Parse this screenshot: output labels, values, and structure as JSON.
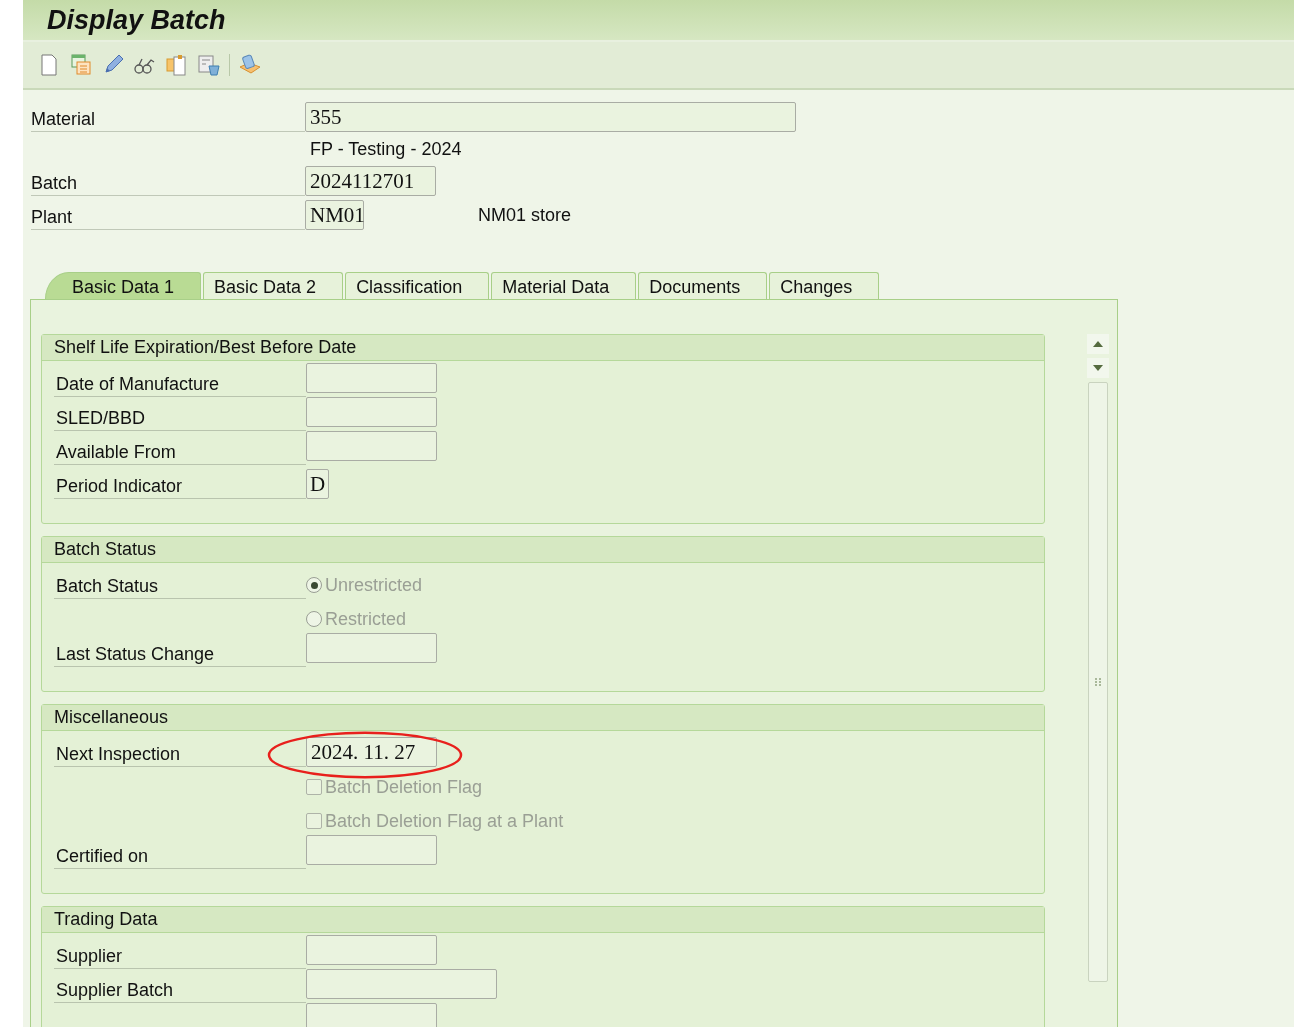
{
  "window": {
    "title": "Display Batch"
  },
  "toolbar": [
    {
      "kind": "document"
    },
    {
      "kind": "windows"
    },
    {
      "kind": "pencil"
    },
    {
      "kind": "glasses"
    },
    {
      "kind": "clipboard"
    },
    {
      "kind": "trash"
    },
    {
      "kind": "separator"
    },
    {
      "kind": "box"
    }
  ],
  "header": [
    {
      "label": "Material",
      "value": "355"
    },
    {
      "text": "FP - Testing - 2024"
    },
    {
      "label": "Batch",
      "value": "2024112701"
    },
    {
      "label": "Plant",
      "value": "NM01",
      "description": "NM01 store"
    }
  ],
  "tabs": [
    {
      "label": "Basic Data 1",
      "selected": true
    },
    {
      "label": "Basic Data 2",
      "selected": false
    },
    {
      "label": "Classification",
      "selected": false
    },
    {
      "label": "Material Data",
      "selected": false
    },
    {
      "label": "Documents",
      "selected": false
    },
    {
      "label": "Changes",
      "selected": false
    }
  ],
  "groups": [
    {
      "title": "Shelf Life Expiration/Best Before Date",
      "rows": [
        {
          "kind": "field",
          "label": "Date of Manufacture"
        },
        {
          "kind": "field",
          "label": "SLED/BBD"
        },
        {
          "kind": "field",
          "label": "Available From"
        },
        {
          "kind": "field",
          "label": "Period Indicator",
          "value": "D"
        }
      ]
    },
    {
      "title": "Batch Status",
      "rows": [
        {
          "kind": "radio",
          "label": "Batch Status",
          "option": "Unrestricted",
          "selected": true,
          "disabled": true
        },
        {
          "kind": "radio",
          "option": "Restricted",
          "selected": false,
          "disabled": true
        },
        {
          "kind": "field",
          "label": "Last Status Change"
        }
      ]
    },
    {
      "title": "Miscellaneous",
      "rows": [
        {
          "kind": "field",
          "label": "Next Inspection",
          "value": "2024. 11. 27",
          "circled": true
        },
        {
          "kind": "checkbox",
          "option": "Batch Deletion Flag",
          "checked": false,
          "disabled": true
        },
        {
          "kind": "checkbox",
          "option": "Batch Deletion Flag at a Plant",
          "checked": false,
          "disabled": true
        },
        {
          "kind": "field",
          "label": "Certified on"
        }
      ]
    },
    {
      "title": "Trading Data",
      "rows": [
        {
          "kind": "field",
          "label": "Supplier"
        },
        {
          "kind": "field",
          "label": "Supplier Batch"
        },
        {
          "kind": "field"
        }
      ]
    }
  ]
}
